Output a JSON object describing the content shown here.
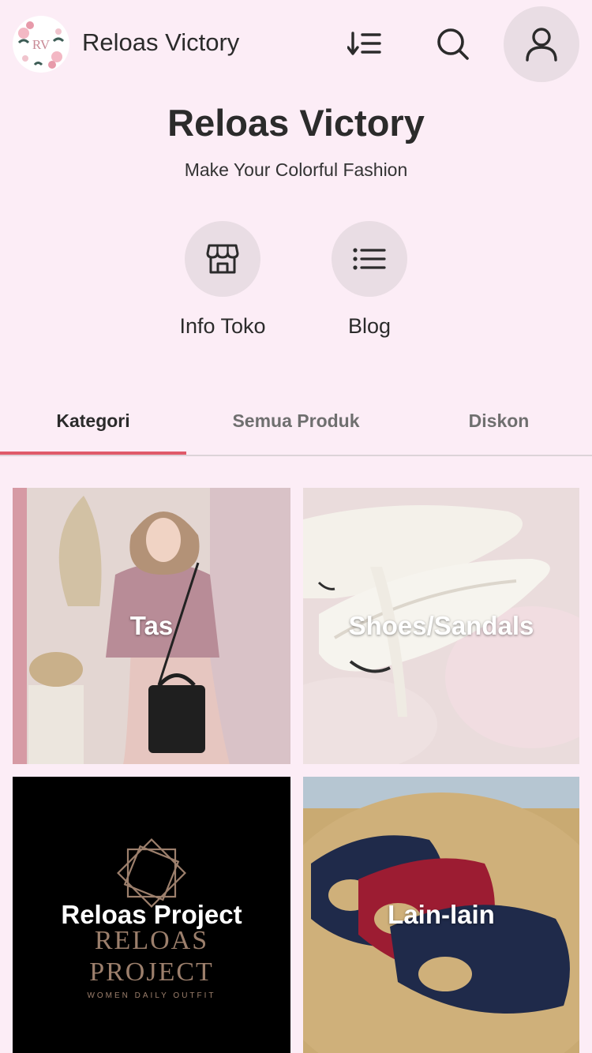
{
  "header": {
    "app_title": "Reloas Victory",
    "logo_text": "RV",
    "sort_icon": "sort-icon",
    "search_icon": "search-icon",
    "account_icon": "account-icon"
  },
  "store": {
    "name": "Reloas Victory",
    "tagline": "Make Your Colorful Fashion"
  },
  "quick_actions": [
    {
      "label": "Info Toko",
      "icon": "store-icon"
    },
    {
      "label": "Blog",
      "icon": "list-icon"
    }
  ],
  "tabs": [
    {
      "label": "Kategori",
      "active": true
    },
    {
      "label": "Semua Produk",
      "active": false
    },
    {
      "label": "Diskon",
      "active": false
    }
  ],
  "categories": [
    {
      "label": "Tas"
    },
    {
      "label": "Shoes/Sandals"
    },
    {
      "label": "Reloas Project",
      "image_text": [
        "RELOAS",
        "PROJECT",
        "WOMEN DAILY OUTFIT"
      ]
    },
    {
      "label": "Lain-lain"
    }
  ],
  "colors": {
    "background": "#fcedf6",
    "accent": "#e05a6a",
    "icon_circle": "#e9dde4"
  }
}
